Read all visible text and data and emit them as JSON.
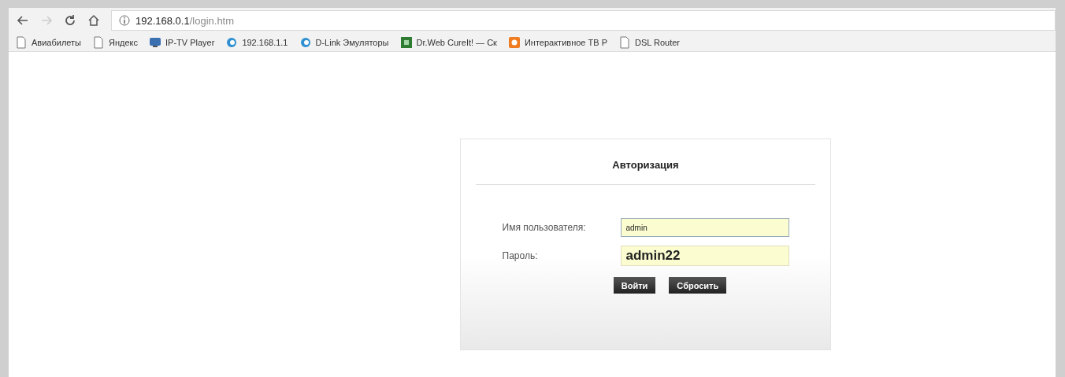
{
  "browser": {
    "address": {
      "host": "192.168.0.1",
      "path": "/login.htm"
    },
    "bookmarks": [
      {
        "label": "Авиабилеты",
        "kind": "page"
      },
      {
        "label": "Яндекс",
        "kind": "page"
      },
      {
        "label": "IP-TV Player",
        "kind": "tv"
      },
      {
        "label": "192.168.1.1",
        "kind": "site"
      },
      {
        "label": "D-Link Эмуляторы",
        "kind": "site"
      },
      {
        "label": "Dr.Web CureIt! — Ск",
        "kind": "app"
      },
      {
        "label": "Интерактивное ТВ Р",
        "kind": "service"
      },
      {
        "label": "DSL Router",
        "kind": "page"
      }
    ]
  },
  "login": {
    "title": "Авторизация",
    "fields": [
      {
        "label": "Имя пользователя:",
        "value": "admin",
        "kind": "small"
      },
      {
        "label": "Пароль:",
        "value": "admin22",
        "kind": "large"
      }
    ],
    "buttons": [
      "Войти",
      "Сбросить"
    ]
  }
}
